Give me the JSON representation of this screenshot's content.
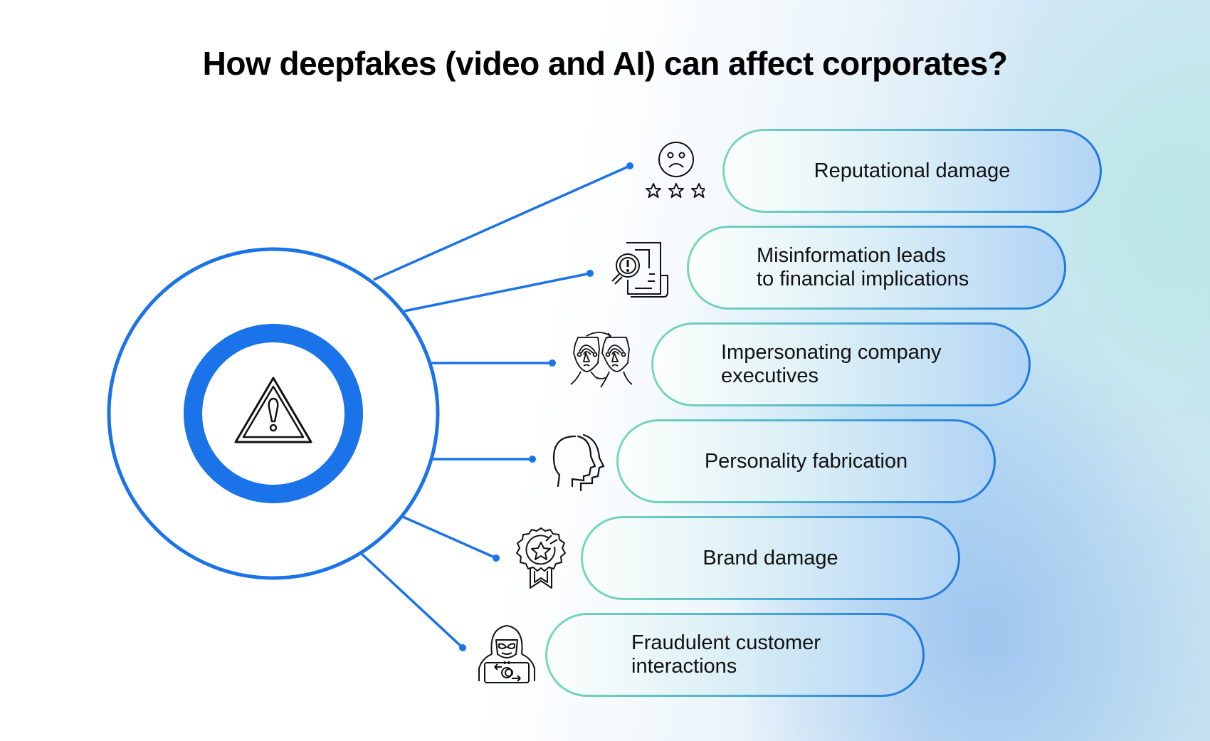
{
  "title": "How deepfakes (video and AI) can affect corporates?",
  "center": {
    "icon": "warning-triangle-icon"
  },
  "colors": {
    "accent_blue": "#1a73e8",
    "pill_border_start": "#7ad9b5",
    "pill_border_end": "#1f78e0",
    "text": "#111111"
  },
  "impacts": [
    {
      "label": "Reputational damage",
      "icon": "sad-face-three-stars-icon"
    },
    {
      "label": "Misinformation leads\nto financial implications",
      "icon": "document-magnifier-alert-icon"
    },
    {
      "label": "Impersonating company\nexecutives",
      "icon": "face-swap-icon"
    },
    {
      "label": "Personality fabrication",
      "icon": "duplicate-head-profile-icon"
    },
    {
      "label": "Brand damage",
      "icon": "broken-award-badge-icon"
    },
    {
      "label": "Fraudulent customer\ninteractions",
      "icon": "hooded-hacker-laptop-icon"
    }
  ]
}
